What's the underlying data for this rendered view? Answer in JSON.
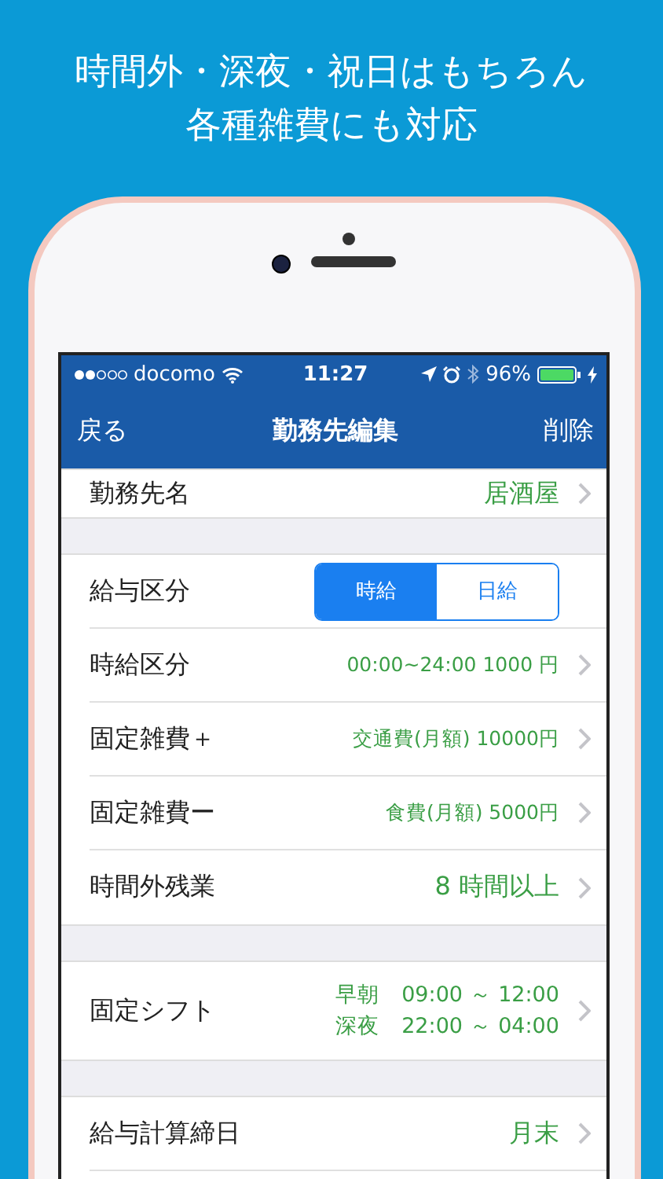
{
  "headline": [
    "時間外・深夜・祝日はもちろん",
    "各種雑費にも対応"
  ],
  "status_bar": {
    "carrier": "docomo",
    "time": "11:27",
    "battery": "96%"
  },
  "nav_bar": {
    "back": "戻る",
    "title": "勤務先編集",
    "action": "削除"
  },
  "sections": [
    {
      "rows": [
        {
          "kind": "value",
          "label": "勤務先名",
          "value": "居酒屋"
        }
      ]
    },
    {
      "rows": [
        {
          "kind": "segmented",
          "label": "給与区分",
          "options": [
            {
              "label": "時給",
              "selected": true
            },
            {
              "label": "日給",
              "selected": false
            }
          ]
        },
        {
          "kind": "detail",
          "label": "時給区分",
          "value": "00:00~24:00 1000 円"
        },
        {
          "kind": "detail",
          "label": "固定雑費＋",
          "value": "交通費(月額) 10000円"
        },
        {
          "kind": "detail",
          "label": "固定雑費ー",
          "value": "食費(月額) 5000円"
        },
        {
          "kind": "value",
          "label": "時間外残業",
          "value": "8 時間以上"
        }
      ]
    },
    {
      "rows": [
        {
          "kind": "shift",
          "label": "固定シフト",
          "shifts": [
            {
              "name": "早朝",
              "time": "09:00 ～ 12:00"
            },
            {
              "name": "深夜",
              "time": "22:00 ～ 04:00"
            }
          ]
        }
      ]
    },
    {
      "rows": [
        {
          "kind": "value",
          "label": "給与計算締日",
          "value": "月末"
        },
        {
          "kind": "empty"
        }
      ]
    }
  ]
}
